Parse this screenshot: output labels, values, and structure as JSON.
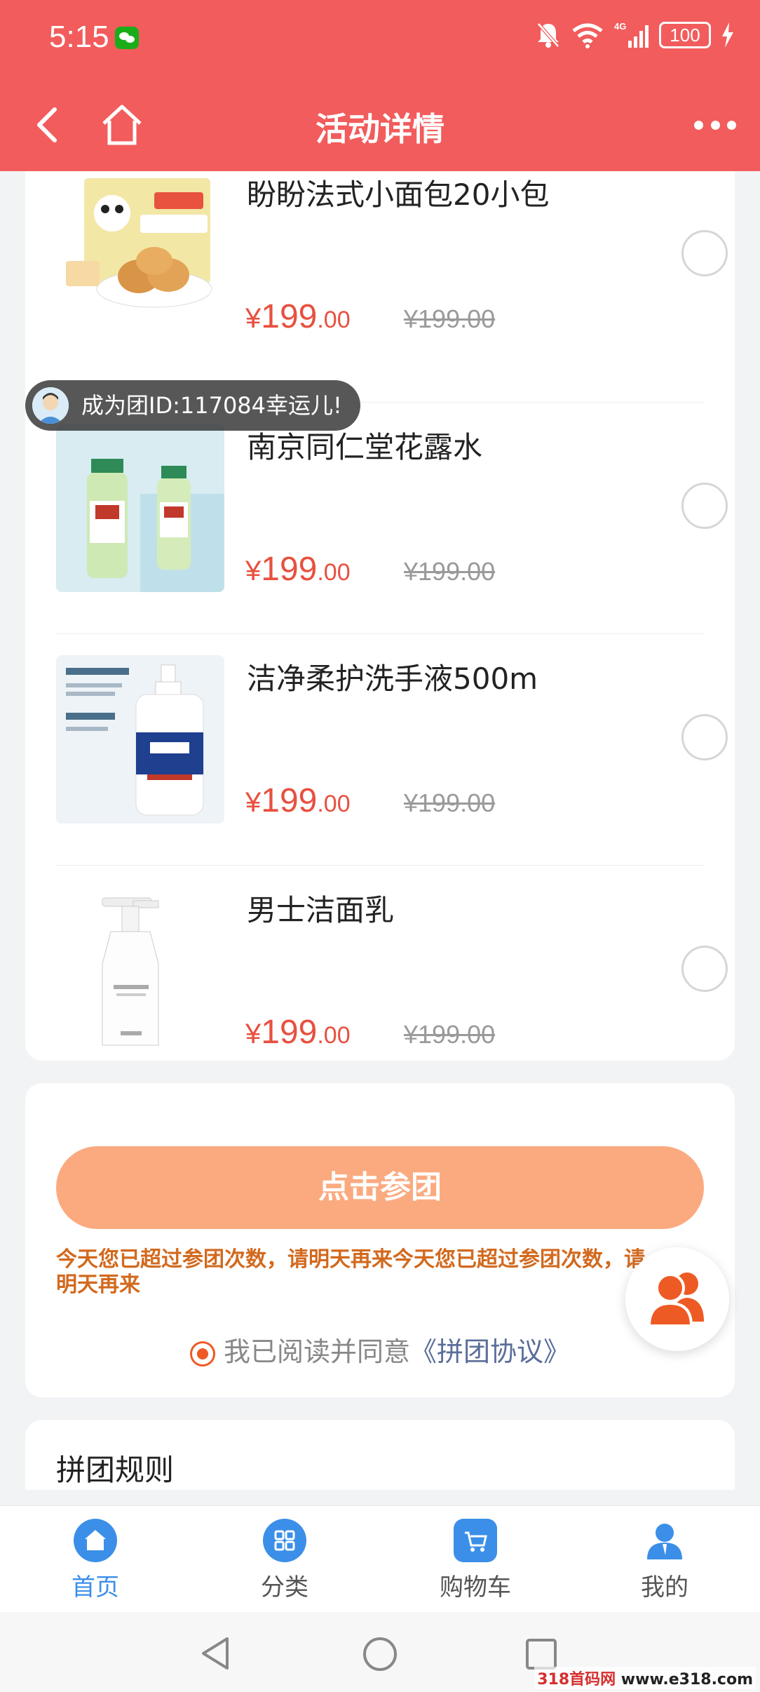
{
  "status_bar": {
    "time": "5:15",
    "battery": "100",
    "network": "4G",
    "icons": [
      "wechat-icon",
      "mute-bell-icon",
      "wifi-icon",
      "signal-icon",
      "battery-icon",
      "charging-icon"
    ]
  },
  "nav": {
    "title": "活动详情",
    "icons": [
      "back-icon",
      "home-icon",
      "more-icon"
    ]
  },
  "products": [
    {
      "name": "盼盼法式小面包20小包",
      "price_currency": "¥",
      "price_int": "199",
      "price_dec": ".00",
      "original_price": "¥199.00",
      "image_icon": "bread-box-image"
    },
    {
      "name": "南京同仁堂花露水",
      "price_currency": "¥",
      "price_int": "199",
      "price_dec": ".00",
      "original_price": "¥199.00",
      "image_icon": "floral-water-image"
    },
    {
      "name": "洁净柔护洗手液500m",
      "price_currency": "¥",
      "price_int": "199",
      "price_dec": ".00",
      "original_price": "¥199.00",
      "image_icon": "hand-soap-image"
    },
    {
      "name": "男士洁面乳",
      "price_currency": "¥",
      "price_int": "199",
      "price_dec": ".00",
      "original_price": "¥199.00",
      "image_icon": "face-wash-image"
    }
  ],
  "toast": {
    "text": "成为团ID:117084幸运儿!"
  },
  "join": {
    "button_label": "点击参团",
    "warning_line1": "今天您已超过参团次数，请明天再来今天您已超过参团次数，请",
    "warning_line2": "明天再来",
    "agree_prefix": "我已阅读并同意",
    "agree_link": "《拼团协议》"
  },
  "rules": {
    "title": "拼团规则"
  },
  "tabs": [
    {
      "label": "首页",
      "icon": "home-tab-icon",
      "active": true
    },
    {
      "label": "分类",
      "icon": "category-tab-icon",
      "active": false
    },
    {
      "label": "购物车",
      "icon": "cart-tab-icon",
      "active": false
    },
    {
      "label": "我的",
      "icon": "profile-tab-icon",
      "active": false
    }
  ],
  "watermark": {
    "part1": "318首码网 ",
    "part2": "www.e318.com"
  },
  "colors": {
    "brand_red": "#f25c5c",
    "price_red": "#e8503f",
    "join_orange": "#fbaa80",
    "tab_blue": "#3b8fe8",
    "float_orange": "#ee5a24"
  }
}
